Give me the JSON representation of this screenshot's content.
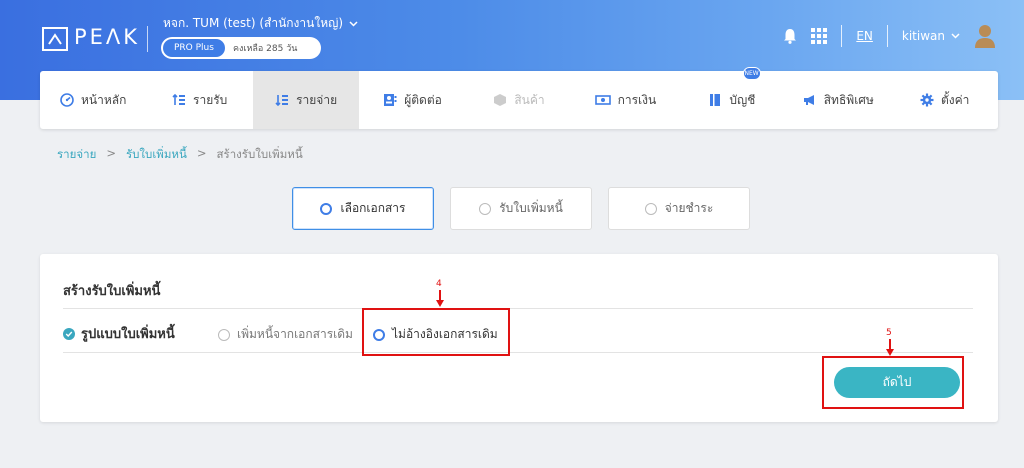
{
  "brand": {
    "logo_text": "PEΛK"
  },
  "header": {
    "company_name": "หจก. TUM (test) (สำนักงานใหญ่)",
    "plan_label": "PRO Plus",
    "plan_remaining": "คงเหลือ 285 วัน",
    "language": "EN",
    "username": "kitiwan"
  },
  "nav": {
    "items": [
      {
        "label": "หน้าหลัก",
        "icon": "dashboard-icon"
      },
      {
        "label": "รายรับ",
        "icon": "income-icon"
      },
      {
        "label": "รายจ่าย",
        "icon": "expense-icon"
      },
      {
        "label": "ผู้ติดต่อ",
        "icon": "contacts-icon"
      },
      {
        "label": "สินค้า",
        "icon": "product-icon"
      },
      {
        "label": "การเงิน",
        "icon": "money-icon"
      },
      {
        "label": "บัญชี",
        "icon": "book-icon",
        "badge": "NEW"
      },
      {
        "label": "สิทธิพิเศษ",
        "icon": "megaphone-icon"
      },
      {
        "label": "ตั้งค่า",
        "icon": "gear-icon"
      }
    ]
  },
  "breadcrumb": {
    "level1": "รายจ่าย",
    "level2": "รับใบเพิ่มหนี้",
    "level3": "สร้างรับใบเพิ่มหนี้",
    "separator": ">"
  },
  "steps": [
    {
      "label": "เลือกเอกสาร",
      "state": "active"
    },
    {
      "label": "รับใบเพิ่มหนี้",
      "state": "inactive"
    },
    {
      "label": "จ่ายชำระ",
      "state": "inactive"
    }
  ],
  "form": {
    "title": "สร้างรับใบเพิ่มหนี้",
    "field_label": "รูปแบบใบเพิ่มหนี้",
    "options": [
      {
        "label": "เพิ่มหนี้จากเอกสารเดิม",
        "selected": false
      },
      {
        "label": "ไม่อ้างอิงเอกสารเดิม",
        "selected": true
      }
    ],
    "next_label": "ถัดไป"
  },
  "annotations": [
    {
      "number": "4"
    },
    {
      "number": "5"
    }
  ],
  "colors": {
    "accent": "#3f7de6",
    "teal": "#3ab5c4",
    "annotation": "#e01212"
  }
}
